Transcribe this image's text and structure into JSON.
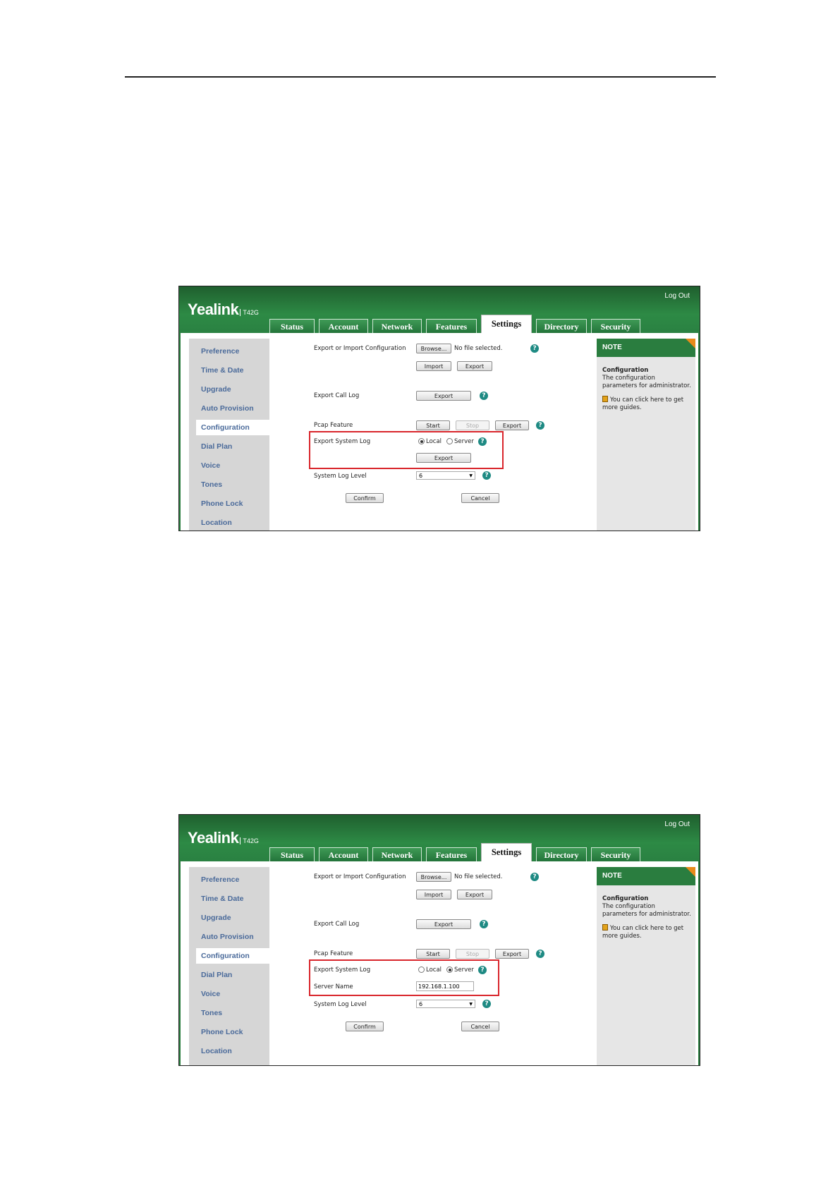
{
  "app": {
    "logo": "Yealink",
    "model": "T42G",
    "logout": "Log Out",
    "tabs": [
      "Status",
      "Account",
      "Network",
      "Features",
      "Settings",
      "Directory",
      "Security"
    ],
    "active_tab": "Settings",
    "sidebar": [
      "Preference",
      "Time & Date",
      "Upgrade",
      "Auto Provision",
      "Configuration",
      "Dial Plan",
      "Voice",
      "Tones",
      "Phone Lock",
      "Location"
    ],
    "active_sidebar": "Configuration",
    "form": {
      "export_import_label": "Export or Import Configuration",
      "browse": "Browse...",
      "no_file": "No file selected.",
      "import": "Import",
      "export": "Export",
      "export_call_log": "Export Call Log",
      "pcap_feature": "Pcap Feature",
      "start": "Start",
      "stop": "Stop",
      "export_system_log": "Export System Log",
      "local": "Local",
      "server": "Server",
      "server_name": "Server Name",
      "server_value": "192.168.1.100",
      "system_log_level": "System Log Level",
      "log_level_value": "6",
      "confirm": "Confirm",
      "cancel": "Cancel"
    },
    "note": {
      "head": "NOTE",
      "title": "Configuration",
      "text": "The configuration parameters for administrator.",
      "guide": "You can click here to get more guides."
    },
    "help_glyph": "?",
    "dropdown_glyph": "▼"
  },
  "screenshot1": {
    "radio_selected": "Local"
  },
  "screenshot2": {
    "radio_selected": "Server"
  }
}
